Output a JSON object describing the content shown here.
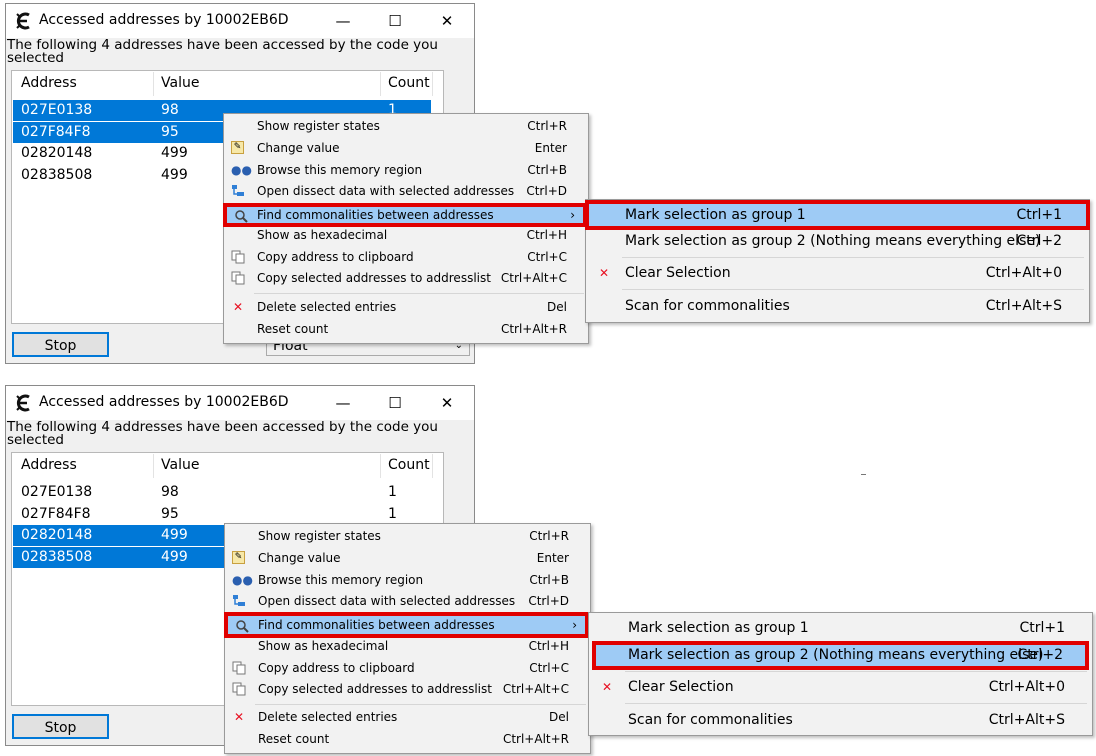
{
  "window": {
    "title": "Accessed addresses by 10002EB6D",
    "description": "The following 4 addresses have been accessed by the code you selected",
    "minimize_glyph": "—",
    "maximize_glyph": "☐",
    "close_glyph": "✕",
    "columns": [
      "Address",
      "Value",
      "Count"
    ],
    "rows": [
      {
        "address": "027E0138",
        "value": "98",
        "count": "1"
      },
      {
        "address": "027F84F8",
        "value": "95",
        "count": "1"
      },
      {
        "address": "02820148",
        "value": "499",
        "count": ""
      },
      {
        "address": "02838508",
        "value": "499",
        "count": ""
      }
    ],
    "stop_label": "Stop",
    "type_combo_value": "Float",
    "icons": [
      "cheat-engine-icon",
      "minimize-icon",
      "maximize-icon",
      "close-icon",
      "dropdown-chevron-icon"
    ]
  },
  "panel2_counts": [
    "1",
    "1",
    "",
    ""
  ],
  "context_menu": {
    "items": [
      {
        "label": "Show register states",
        "shortcut": "Ctrl+R",
        "icon": ""
      },
      {
        "label": "Change value",
        "shortcut": "Enter",
        "icon": "pencil-icon"
      },
      {
        "label": "Browse this memory region",
        "shortcut": "Ctrl+B",
        "icon": "binoculars-icon"
      },
      {
        "label": "Open dissect data with selected addresses",
        "shortcut": "Ctrl+D",
        "icon": "structure-icon"
      },
      {
        "label": "Find commonalities between addresses",
        "shortcut": "›",
        "icon": "magnifier-icon"
      },
      {
        "label": "Show as hexadecimal",
        "shortcut": "Ctrl+H",
        "icon": ""
      },
      {
        "label": "Copy address to clipboard",
        "shortcut": "Ctrl+C",
        "icon": "copy-icon"
      },
      {
        "label": "Copy selected addresses to addresslist",
        "shortcut": "Ctrl+Alt+C",
        "icon": "copy-icon"
      },
      {
        "label": "Delete selected entries",
        "shortcut": "Del",
        "icon": "delete-x-icon"
      },
      {
        "label": "Reset count",
        "shortcut": "Ctrl+Alt+R",
        "icon": ""
      }
    ]
  },
  "submenu": {
    "items": [
      {
        "label": "Mark selection as group 1",
        "shortcut": "Ctrl+1"
      },
      {
        "label": "Mark selection as group 2 (Nothing means everything else)",
        "shortcut": "Ctrl+2"
      },
      {
        "label": "Clear Selection",
        "shortcut": "Ctrl+Alt+0",
        "icon": "clear-x-icon"
      },
      {
        "label": "Scan for commonalities",
        "shortcut": "Ctrl+Alt+S"
      }
    ]
  },
  "colors": {
    "selection": "#0078d7",
    "menu_highlight": "#9ecbf5",
    "callout_red": "#e00000"
  }
}
